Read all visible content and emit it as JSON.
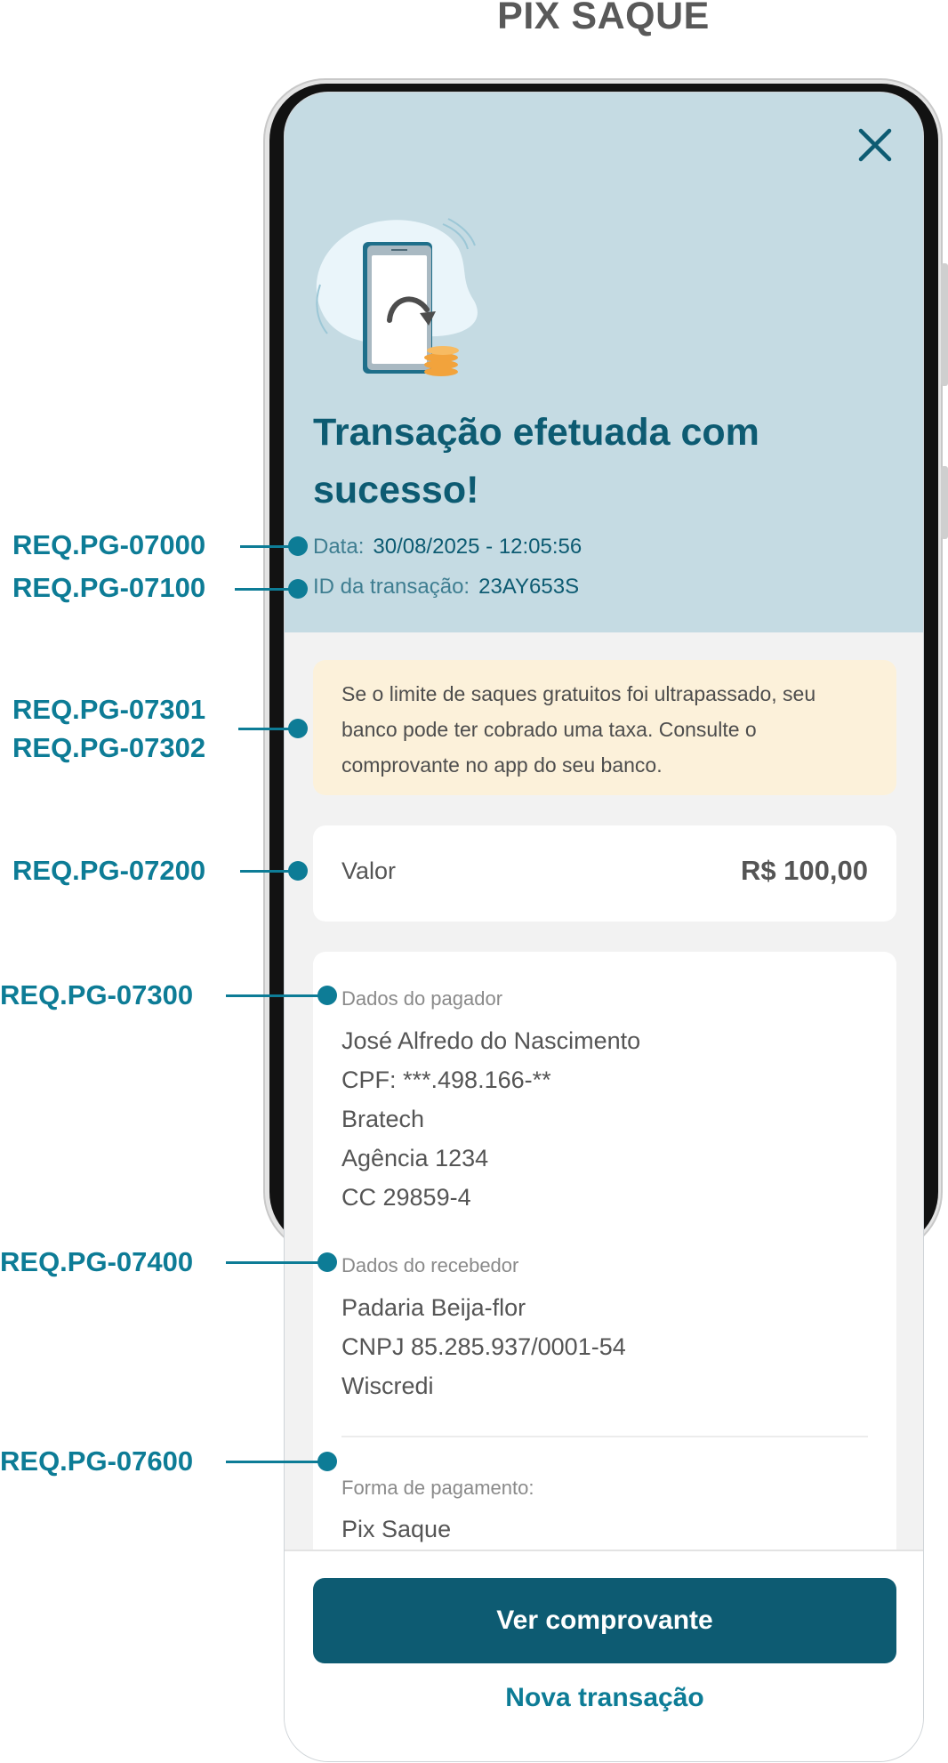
{
  "page": {
    "title": "PIX SAQUE"
  },
  "hero": {
    "title": "Transação efetuada com sucesso!",
    "date_label": "Data:",
    "date_value": "30/08/2025 - 12:05:56",
    "id_label": "ID da transação:",
    "id_value": "23AY653S"
  },
  "notice": {
    "text": "Se o limite de saques gratuitos foi ultrapassado, seu banco pode ter cobrado uma taxa. Consulte o comprovante no app do seu banco."
  },
  "value_card": {
    "label": "Valor",
    "amount": "R$ 100,00"
  },
  "payer": {
    "section_label": "Dados do pagador",
    "lines": [
      "José Alfredo do Nascimento",
      "CPF: ***.498.166-**",
      "Bratech",
      "Agência 1234",
      "CC 29859-4"
    ]
  },
  "receiver": {
    "section_label": "Dados do recebedor",
    "lines": [
      "Padaria Beija-flor",
      "CNPJ 85.285.937/0001-54",
      "Wiscredi"
    ]
  },
  "payment": {
    "section_label": "Forma de pagamento:",
    "method": "Pix Saque"
  },
  "actions": {
    "primary": "Ver comprovante",
    "secondary": "Nova transação"
  },
  "annotations": [
    "REQ.PG-07000",
    "REQ.PG-07100",
    "REQ.PG-07301",
    "REQ.PG-07302",
    "REQ.PG-07200",
    "REQ.PG-07300",
    "REQ.PG-07400",
    "REQ.PG-07600"
  ],
  "colors": {
    "brand_primary": "#0d5b72",
    "annotation": "#0d7c96",
    "hero_background": "#c5dbe3",
    "notice_background": "#fcf1da"
  },
  "icons": {
    "close": "close-icon",
    "illustration": "phone-withdraw-illustration"
  }
}
